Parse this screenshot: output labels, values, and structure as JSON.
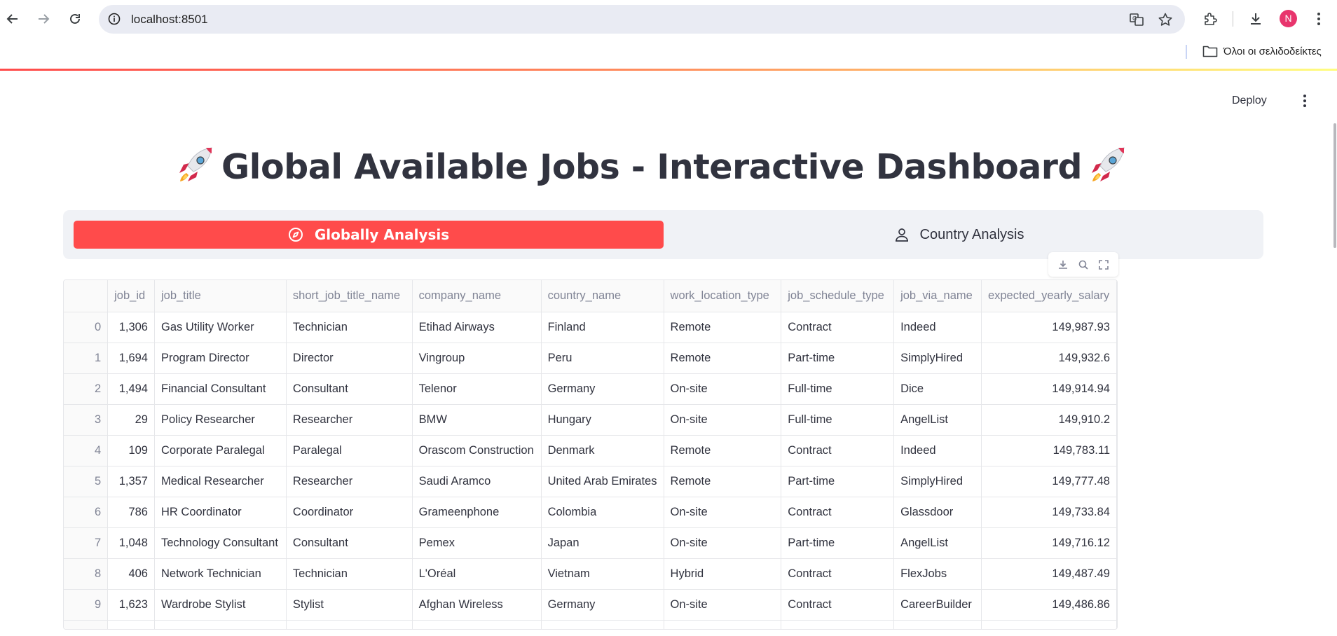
{
  "browser": {
    "url": "localhost:8501",
    "avatar_letter": "N",
    "bookmarks_label": "Όλοι οι σελιδοδείκτες"
  },
  "app": {
    "deploy_label": "Deploy",
    "title": "Global Available Jobs - Interactive Dashboard",
    "title_icon": "rocket-icon"
  },
  "tabs": [
    {
      "label": "Globally Analysis",
      "icon": "compass-icon",
      "active": true
    },
    {
      "label": "Country Analysis",
      "icon": "person-pin-icon",
      "active": false
    }
  ],
  "table_toolbar": [
    "download-icon",
    "search-icon",
    "fullscreen-icon"
  ],
  "table": {
    "columns": [
      "",
      "job_id",
      "job_title",
      "short_job_title_name",
      "company_name",
      "country_name",
      "work_location_type",
      "job_schedule_type",
      "job_via_name",
      "expected_yearly_salary"
    ],
    "rows": [
      [
        "0",
        "1,306",
        "Gas Utility Worker",
        "Technician",
        "Etihad Airways",
        "Finland",
        "Remote",
        "Contract",
        "Indeed",
        "149,987.93"
      ],
      [
        "1",
        "1,694",
        "Program Director",
        "Director",
        "Vingroup",
        "Peru",
        "Remote",
        "Part-time",
        "SimplyHired",
        "149,932.6"
      ],
      [
        "2",
        "1,494",
        "Financial Consultant",
        "Consultant",
        "Telenor",
        "Germany",
        "On-site",
        "Full-time",
        "Dice",
        "149,914.94"
      ],
      [
        "3",
        "29",
        "Policy Researcher",
        "Researcher",
        "BMW",
        "Hungary",
        "On-site",
        "Full-time",
        "AngelList",
        "149,910.2"
      ],
      [
        "4",
        "109",
        "Corporate Paralegal",
        "Paralegal",
        "Orascom Construction",
        "Denmark",
        "Remote",
        "Contract",
        "Indeed",
        "149,783.11"
      ],
      [
        "5",
        "1,357",
        "Medical Researcher",
        "Researcher",
        "Saudi Aramco",
        "United Arab Emirates",
        "Remote",
        "Part-time",
        "SimplyHired",
        "149,777.48"
      ],
      [
        "6",
        "786",
        "HR Coordinator",
        "Coordinator",
        "Grameenphone",
        "Colombia",
        "On-site",
        "Contract",
        "Glassdoor",
        "149,733.84"
      ],
      [
        "7",
        "1,048",
        "Technology Consultant",
        "Consultant",
        "Pemex",
        "Japan",
        "On-site",
        "Part-time",
        "AngelList",
        "149,716.12"
      ],
      [
        "8",
        "406",
        "Network Technician",
        "Technician",
        "L'Oréal",
        "Vietnam",
        "Hybrid",
        "Contract",
        "FlexJobs",
        "149,487.49"
      ],
      [
        "9",
        "1,623",
        "Wardrobe Stylist",
        "Stylist",
        "Afghan Wireless",
        "Germany",
        "On-site",
        "Contract",
        "CareerBuilder",
        "149,486.86"
      ]
    ]
  }
}
